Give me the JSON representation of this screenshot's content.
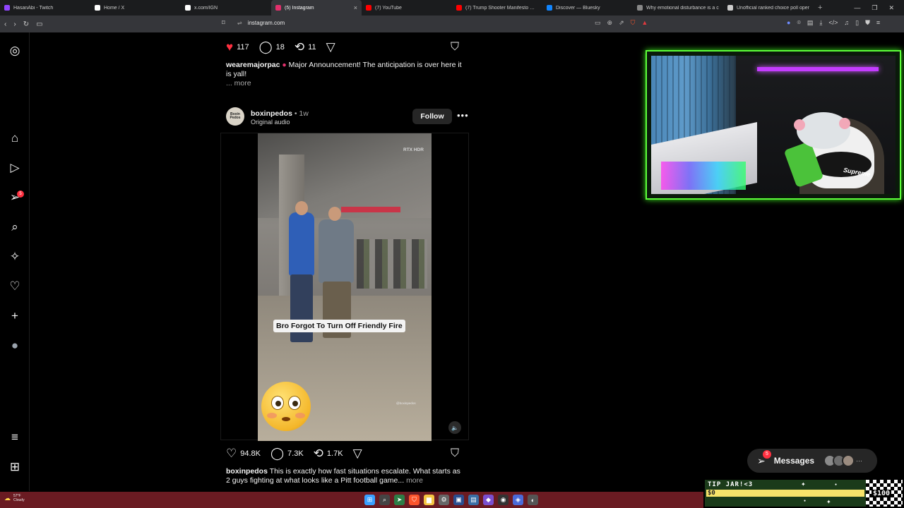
{
  "browser": {
    "tabs": [
      {
        "title": "HasanAbi - Twitch",
        "color": "#9146ff",
        "active": false
      },
      {
        "title": "Home / X",
        "color": "#ffffff",
        "active": false
      },
      {
        "title": "x.com/IGN",
        "color": "#ffffff",
        "active": false
      },
      {
        "title": "(5) Instagram",
        "color": "#e1306c",
        "active": true
      },
      {
        "title": "(7) YouTube",
        "color": "#ff0000",
        "active": false
      },
      {
        "title": "(7) Trump Shooter Manifesto Gets",
        "color": "#ff0000",
        "active": false
      },
      {
        "title": "Discover — Bluesky",
        "color": "#1185fe",
        "active": false
      },
      {
        "title": "Why emotional disturbance is a c",
        "color": "#888888",
        "active": false
      },
      {
        "title": "Unofficial ranked choice poll oper",
        "color": "#cccccc",
        "active": false
      }
    ],
    "url": "instagram.com"
  },
  "sidebar": {
    "items": [
      {
        "name": "instagram-logo-icon",
        "glyph": "◎"
      },
      {
        "name": "home-icon",
        "glyph": "⌂"
      },
      {
        "name": "reels-icon",
        "glyph": "▷"
      },
      {
        "name": "messages-icon",
        "glyph": "➢"
      },
      {
        "name": "search-icon",
        "glyph": "⌕"
      },
      {
        "name": "explore-icon",
        "glyph": "✧"
      },
      {
        "name": "notifications-heart-icon",
        "glyph": "♡"
      },
      {
        "name": "create-plus-icon",
        "glyph": "+"
      },
      {
        "name": "profile-avatar-icon",
        "glyph": "●"
      },
      {
        "name": "menu-icon",
        "glyph": "≡"
      },
      {
        "name": "threads-apps-icon",
        "glyph": "⊞"
      }
    ],
    "messages_badge": "5"
  },
  "post1": {
    "likes": "117",
    "comments": "18",
    "reposts": "11",
    "username": "wearemajorpac",
    "caption": "Major Announcement! The anticipation is over here it is yall!",
    "more": "... more"
  },
  "post2": {
    "avatar_text": "Boxin Pedos",
    "username": "boxinpedos",
    "time": "• 1w",
    "audio": "Original audio",
    "follow_label": "Follow",
    "video_caption": "Bro Forgot To Turn Off Friendly Fire",
    "rtx_label": "RTX HDR",
    "watermark": "@boxinpedos",
    "likes": "94.8K",
    "comments": "7.3K",
    "reposts": "1.7K",
    "caption": "This is exactly how fast situations escalate. What starts as 2 guys fighting at what looks like a Pitt football game...",
    "more": "more"
  },
  "messages": {
    "label": "Messages",
    "badge": "5"
  },
  "taskbar": {
    "temp": "57°F",
    "condition": "Cloudy"
  },
  "tipjar": {
    "title": "TIP JAR!<3",
    "current": "$0",
    "goal": "$100",
    "progress": 0
  },
  "webcam": {
    "hat_text": "Supreme"
  }
}
